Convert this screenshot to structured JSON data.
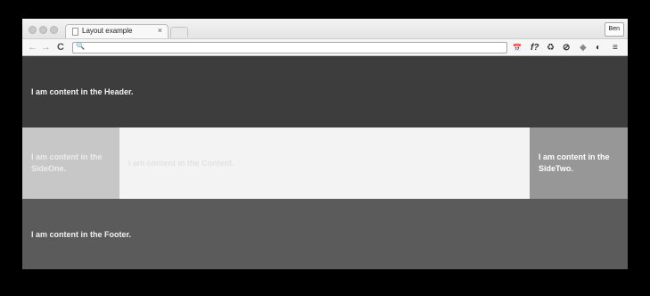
{
  "browser": {
    "tab_title": "Layout example",
    "tab_close": "×",
    "user_button": "Ben",
    "nav": {
      "back": "←",
      "forward": "→",
      "reload": "C"
    },
    "search_icon": "🔍",
    "address_value": "",
    "extensions": [
      "📅",
      "f?",
      "♻",
      "⊘",
      "◆",
      "◐",
      "≡"
    ]
  },
  "page": {
    "header": "I am content in the Header.",
    "side_one": "I am content in the SideOne.",
    "content": "I am content in the Content.",
    "side_two": "I am content in the SideTwo.",
    "footer": "I am content in the Footer."
  },
  "colors": {
    "header_bg": "#3d3d3d",
    "side_one_bg": "#c7c7c7",
    "content_bg": "#f3f3f3",
    "side_two_bg": "#979797",
    "footer_bg": "#5b5b5b"
  }
}
